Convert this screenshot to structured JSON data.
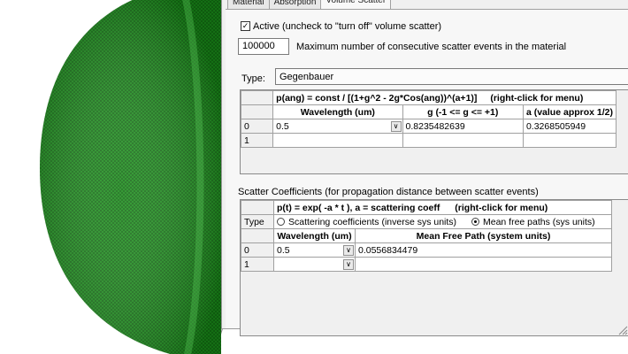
{
  "tabs": [
    "Material",
    "Absorption",
    "Volume Scatter"
  ],
  "active": {
    "checked": true,
    "label": "Active  (uncheck to \"turn off\" volume scatter)"
  },
  "max_events": {
    "value": "100000",
    "label": "Maximum number of consecutive scatter events in the material"
  },
  "type": {
    "label": "Type:",
    "value": "Gegenbauer"
  },
  "phase_table": {
    "formula": "p(ang) = const / [(1+g^2 - 2g*Cos(ang))^(a+1)]",
    "menu_hint": "(right-click for menu)",
    "headers": [
      "Wavelength (um)",
      "g  (-1 <= g <= +1)",
      "a  (value approx 1/2)"
    ],
    "rows": [
      {
        "index": "0",
        "wavelength": "0.5",
        "g": "0.8235482639",
        "a": "0.3268505949"
      },
      {
        "index": "1",
        "wavelength": "",
        "g": "",
        "a": ""
      }
    ]
  },
  "scatter_coeff": {
    "section_label": "Scatter Coefficients  (for propagation distance between scatter events)",
    "formula": "p(t) = exp( -a * t ),    a = scattering coeff",
    "menu_hint": "(right-click for menu)",
    "type_label": "Type",
    "option_coeff": "Scattering coefficients (inverse sys units)",
    "option_mfp": "Mean free paths (sys units)",
    "selected": "mfp",
    "headers": [
      "Wavelength (um)",
      "Mean Free Path (system units)"
    ],
    "rows": [
      {
        "index": "0",
        "wavelength": "0.5",
        "value": "0.0556834479"
      },
      {
        "index": "1",
        "wavelength": "",
        "value": ""
      }
    ]
  },
  "colors": {
    "mesh": "#1e8a1e",
    "mesh_light": "#4fc04f",
    "dialog_bg": "#f0f0f0"
  }
}
